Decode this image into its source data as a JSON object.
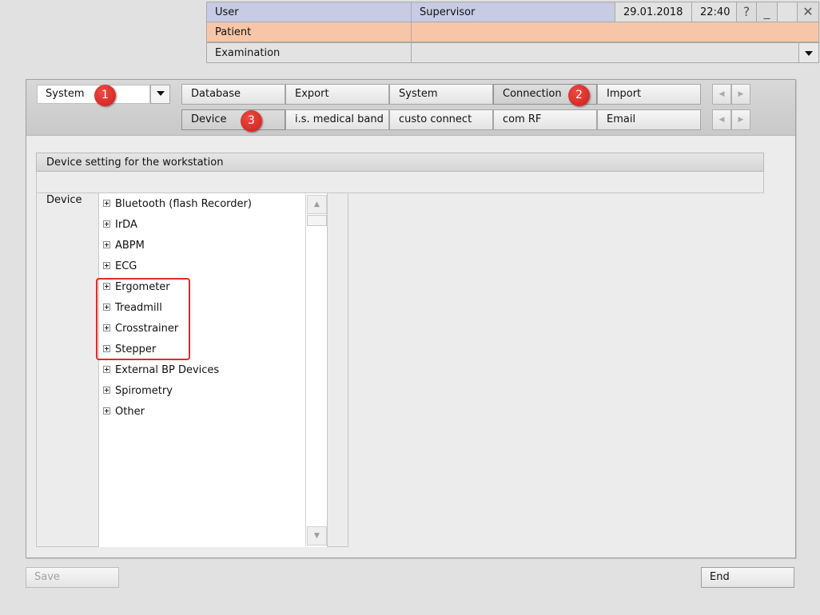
{
  "header": {
    "user_label": "User",
    "user_value": "Supervisor",
    "date": "29.01.2018",
    "time": "22:40",
    "help_symbol": "?",
    "minimize_symbol": "_",
    "close_symbol": "✕",
    "patient_label": "Patient",
    "examination_label": "Examination",
    "examination_dropdown_icon": "chevron-down-icon"
  },
  "category_select": {
    "value": "System",
    "dropdown_icon": "chevron-down-icon"
  },
  "tabs_row1": [
    "Database",
    "Export",
    "System",
    "Connection",
    "Import"
  ],
  "tabs_row2": [
    "Device",
    "i.s. medical band",
    "custo connect",
    "com RF",
    "Email"
  ],
  "active_tabs": {
    "row1": "Connection",
    "row2": "Device"
  },
  "markers": [
    "1",
    "2",
    "3"
  ],
  "section": {
    "title": "Device setting for the workstation",
    "device_label": "Device"
  },
  "tree": {
    "items": [
      "Bluetooth (flash Recorder)",
      "IrDA",
      "ABPM",
      "ECG",
      "Ergometer",
      "Treadmill",
      "Crosstrainer",
      "Stepper",
      "External BP Devices",
      "Spirometry",
      "Other"
    ],
    "highlighted": [
      "Ergometer",
      "Treadmill",
      "Crosstrainer",
      "Stepper"
    ]
  },
  "footer": {
    "save_label": "Save",
    "end_label": "End"
  },
  "colors": {
    "user_bar": "#c7cbe4",
    "patient_bar": "#f7c6a8",
    "marker": "#d9302b",
    "highlight_box": "#e0292b"
  }
}
